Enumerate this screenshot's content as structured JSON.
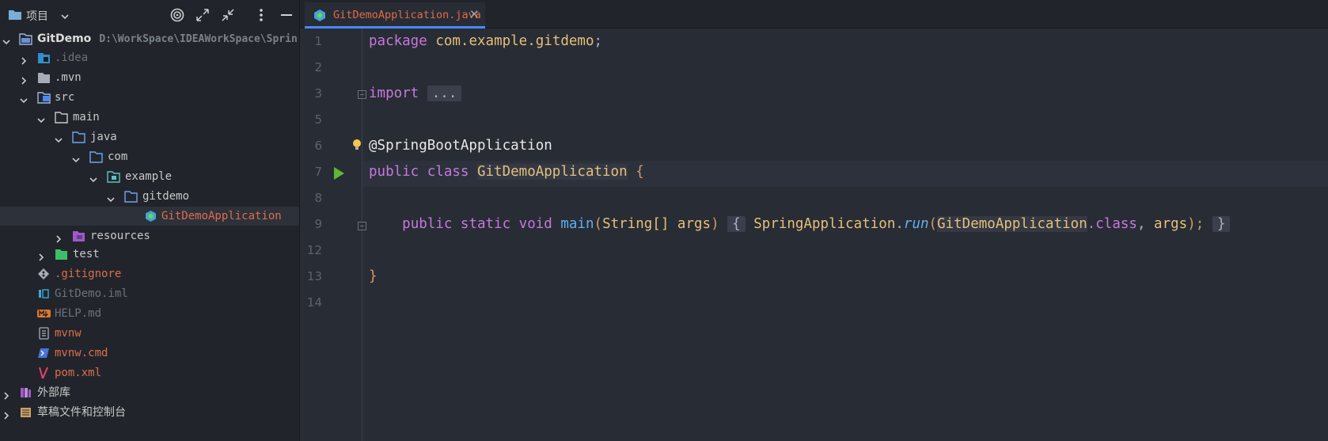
{
  "project_panel": {
    "title": "项目",
    "tree": [
      {
        "label": "GitDemo",
        "path": "D:\\WorkSpace\\IDEAWorkSpace\\Sprin",
        "icon": "module-folder-icon",
        "expanded": true
      },
      {
        "label": ".idea",
        "icon": "idea-folder-icon",
        "expanded": false
      },
      {
        "label": ".mvn",
        "icon": "folder-icon",
        "expanded": false
      },
      {
        "label": "src",
        "icon": "source-folder-icon",
        "expanded": true
      },
      {
        "label": "main",
        "icon": "folder-icon",
        "expanded": true
      },
      {
        "label": "java",
        "icon": "source-root-folder-icon",
        "expanded": true
      },
      {
        "label": "com",
        "icon": "package-folder-icon",
        "expanded": true
      },
      {
        "label": "example",
        "icon": "package-folder-icon",
        "expanded": true
      },
      {
        "label": "gitdemo",
        "icon": "package-folder-icon",
        "expanded": true
      },
      {
        "label": "GitDemoApplication",
        "icon": "spring-boot-class-icon"
      },
      {
        "label": "resources",
        "icon": "resources-folder-icon",
        "expanded": false
      },
      {
        "label": "test",
        "icon": "test-folder-icon",
        "expanded": false
      },
      {
        "label": ".gitignore",
        "icon": "git-icon"
      },
      {
        "label": "GitDemo.iml",
        "icon": "iml-file-icon"
      },
      {
        "label": "HELP.md",
        "icon": "markdown-file-icon"
      },
      {
        "label": "mvnw",
        "icon": "script-file-icon"
      },
      {
        "label": "mvnw.cmd",
        "icon": "cmd-file-icon"
      },
      {
        "label": "pom.xml",
        "icon": "maven-icon"
      },
      {
        "label": "外部库",
        "icon": "library-icon",
        "expanded": false
      },
      {
        "label": "草稿文件和控制台",
        "icon": "scratches-icon",
        "expanded": false
      }
    ]
  },
  "editor": {
    "tab_label": "GitDemoApplication.java",
    "line_numbers": [
      "1",
      "2",
      "3",
      "5",
      "6",
      "7",
      "8",
      "9",
      "12",
      "13",
      "14"
    ],
    "code": {
      "l1_kw": "package",
      "l1_pkg": "com.example.gitdemo",
      "l1_semi": ";",
      "l3_kw": "import",
      "l3_fold": "...",
      "l6_ann": "@SpringBootApplication",
      "l7_kw": "public class",
      "l7_cls": "GitDemoApplication",
      "l7_brace": "{",
      "l9_kw": "public static void",
      "l9_fn": "main",
      "l9_open": "(",
      "l9_type": "String[]",
      "l9_param": "args",
      "l9_close": ")",
      "l9_lbrace": "{",
      "l9_cls": "SpringApplication",
      "l9_dot": ".",
      "l9_run": "run",
      "l9_paren": "(",
      "l9_arg1": "GitDemoApplication",
      "l9_dotclass": ".class",
      "l9_comma": ", ",
      "l9_arg2": "args",
      "l9_end": ");",
      "l9_rbrace": "}",
      "l13_brace": "}"
    }
  },
  "colors": {
    "accent": "#4a88f7",
    "keyword": "#c678dd",
    "type": "#e5c07b",
    "run_icon": "#5fb832"
  }
}
